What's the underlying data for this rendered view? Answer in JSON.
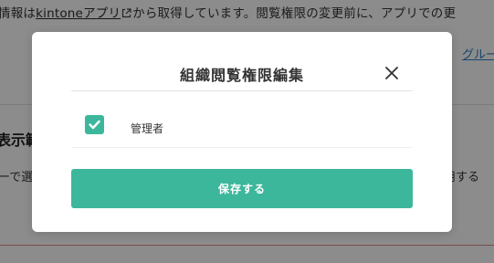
{
  "background": {
    "info_prefix": "情報は",
    "info_link": "kintoneアプリ",
    "info_suffix": "から取得しています。閲覧権限の変更前に、アプリでの更",
    "group_link": "グルー",
    "section_title": "表示範",
    "desc_left": "ーで選",
    "desc_right": "用する"
  },
  "modal": {
    "title": "組織閲覧権限編集",
    "close_icon": "close-icon",
    "items": [
      {
        "label": "管理者",
        "checked": true
      }
    ],
    "save_label": "保存する"
  },
  "colors": {
    "accent": "#3db79c",
    "overlay": "rgba(0,0,0,0.45)",
    "link": "#2e7fc4"
  }
}
